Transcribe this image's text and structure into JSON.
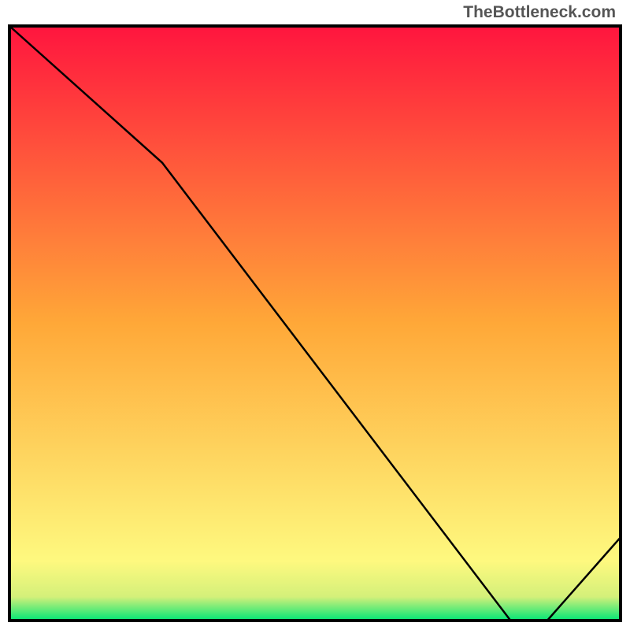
{
  "watermark": "TheBottleneck.com",
  "chart_data": {
    "type": "line",
    "title": "",
    "xlabel": "",
    "ylabel": "",
    "xlim": [
      0,
      100
    ],
    "ylim": [
      0,
      100
    ],
    "x": [
      0,
      25,
      82,
      88,
      100
    ],
    "y": [
      100,
      77,
      0,
      0,
      14
    ],
    "gradient_stops": [
      {
        "offset": 0,
        "color": "#00e676"
      },
      {
        "offset": 4,
        "color": "#d4f07a"
      },
      {
        "offset": 10,
        "color": "#fef97f"
      },
      {
        "offset": 50,
        "color": "#ffa838"
      },
      {
        "offset": 100,
        "color": "#ff153e"
      }
    ],
    "line_color": "#000000",
    "border_color": "#000000"
  }
}
